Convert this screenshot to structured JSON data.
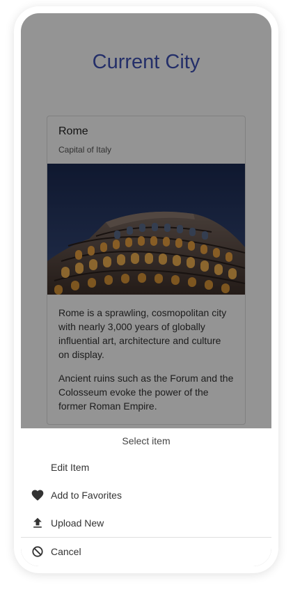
{
  "page": {
    "title": "Current City"
  },
  "card": {
    "title": "Rome",
    "subtitle": "Capital of Italy",
    "image_alt": "Colosseum at night",
    "paragraphs": [
      "Rome is a sprawling, cosmopolitan city with nearly 3,000 years of globally influential art, architecture and culture on display.",
      "Ancient ruins such as the Forum and the Colosseum evoke the power of the former Roman Empire."
    ]
  },
  "action_sheet": {
    "header": "Select item",
    "items": [
      {
        "label": "Edit Item",
        "icon": ""
      },
      {
        "label": "Add to Favorites",
        "icon": "heart-icon"
      },
      {
        "label": "Upload New",
        "icon": "upload-icon"
      },
      {
        "label": "Cancel",
        "icon": "block-icon"
      }
    ]
  },
  "colors": {
    "title": "#3f51b5",
    "scrim": "rgba(0,0,0,0.42)"
  }
}
